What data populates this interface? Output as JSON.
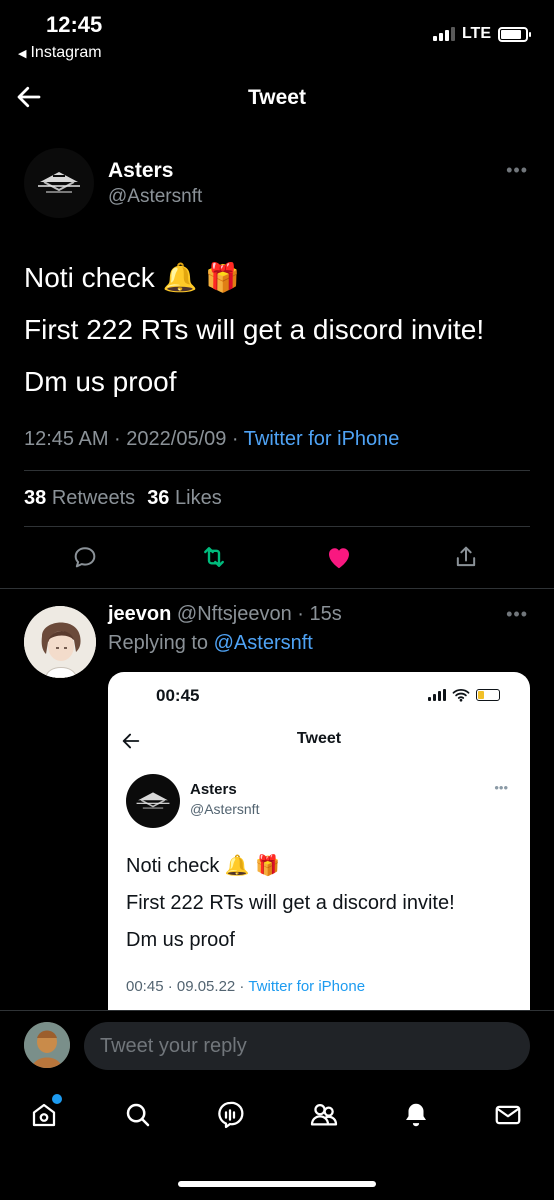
{
  "status_bar": {
    "time": "12:45",
    "back_app": "Instagram",
    "network": "LTE"
  },
  "header": {
    "title": "Tweet"
  },
  "tweet": {
    "author_name": "Asters",
    "author_handle": "@Astersnft",
    "text_lines": [
      "Noti check 🔔 🎁",
      "First 222 RTs will get a discord invite!",
      "Dm us proof"
    ],
    "timestamp": "12:45 AM · 2022/05/09 · ",
    "source": "Twitter for iPhone",
    "retweets_count": "38",
    "retweets_label": "Retweets",
    "likes_count": "36",
    "likes_label": "Likes",
    "liked": true
  },
  "reply": {
    "author_name": "jeevon",
    "author_meta": "@Nftsjeevon · 15s",
    "replying_to_label": "Replying to ",
    "replying_to_handle": "@Astersnft",
    "embedded_screenshot": {
      "time": "00:45",
      "title": "Tweet",
      "author_name": "Asters",
      "author_handle": "@Astersnft",
      "text_lines": [
        "Noti check 🔔 🎁",
        "First 222 RTs will get a discord invite!",
        "Dm us proof"
      ],
      "timestamp": "00:45 · 09.05.22 · ",
      "source": "Twitter for iPhone"
    }
  },
  "composer": {
    "placeholder": "Tweet your reply"
  },
  "tabbar": {
    "items": [
      "home-icon",
      "search-icon",
      "spaces-icon",
      "communities-icon",
      "notifications-icon",
      "messages-icon"
    ],
    "home_has_dot": true
  },
  "colors": {
    "accent": "#1d9bf0",
    "like": "#f91880",
    "retweet": "#00ba7c",
    "background": "#000000"
  }
}
